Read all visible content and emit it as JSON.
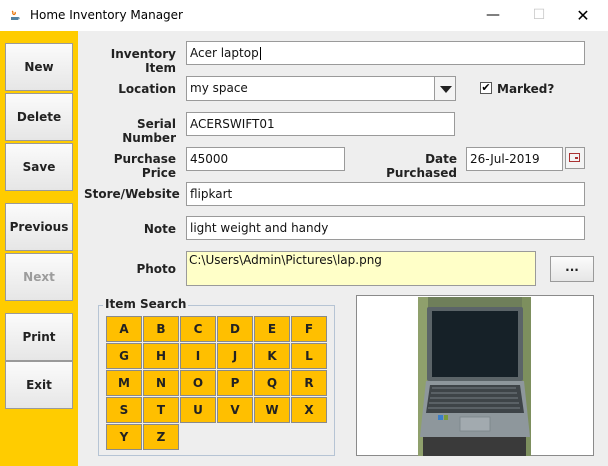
{
  "window": {
    "title": "Home Inventory Manager",
    "min_glyph": "—",
    "max_glyph": "☐",
    "close_glyph": "✕"
  },
  "sidebar": {
    "new": "New",
    "delete": "Delete",
    "save": "Save",
    "previous": "Previous",
    "next": "Next",
    "print": "Print",
    "exit": "Exit"
  },
  "form": {
    "inventory_item": {
      "label": "Inventory Item",
      "value": "Acer laptop"
    },
    "location": {
      "label": "Location",
      "value": "my space"
    },
    "marked": {
      "label": "Marked?",
      "checked": true,
      "glyph": "✔"
    },
    "serial_number": {
      "label": "Serial Number",
      "value": "ACERSWIFT01"
    },
    "purchase_price": {
      "label": "Purchase Price",
      "value": "45000"
    },
    "date_purchased": {
      "label": "Date Purchased",
      "value": "26-Jul-2019"
    },
    "store_website": {
      "label": "Store/Website",
      "value": "flipkart"
    },
    "note": {
      "label": "Note",
      "value": "light weight and handy"
    },
    "photo": {
      "label": "Photo",
      "value": "C:\\Users\\Admin\\Pictures\\lap.png",
      "browse_label": "..."
    }
  },
  "item_search": {
    "title": "Item Search",
    "letters": [
      "A",
      "B",
      "C",
      "D",
      "E",
      "F",
      "G",
      "H",
      "I",
      "J",
      "K",
      "L",
      "M",
      "N",
      "O",
      "P",
      "Q",
      "R",
      "S",
      "T",
      "U",
      "V",
      "W",
      "X",
      "Y",
      "Z"
    ]
  },
  "colors": {
    "sidebar": "#ffcc00",
    "letter_button": "#ffbf00",
    "photo_path_bg": "#ffffc8",
    "panel_bg": "#eeeeee"
  }
}
